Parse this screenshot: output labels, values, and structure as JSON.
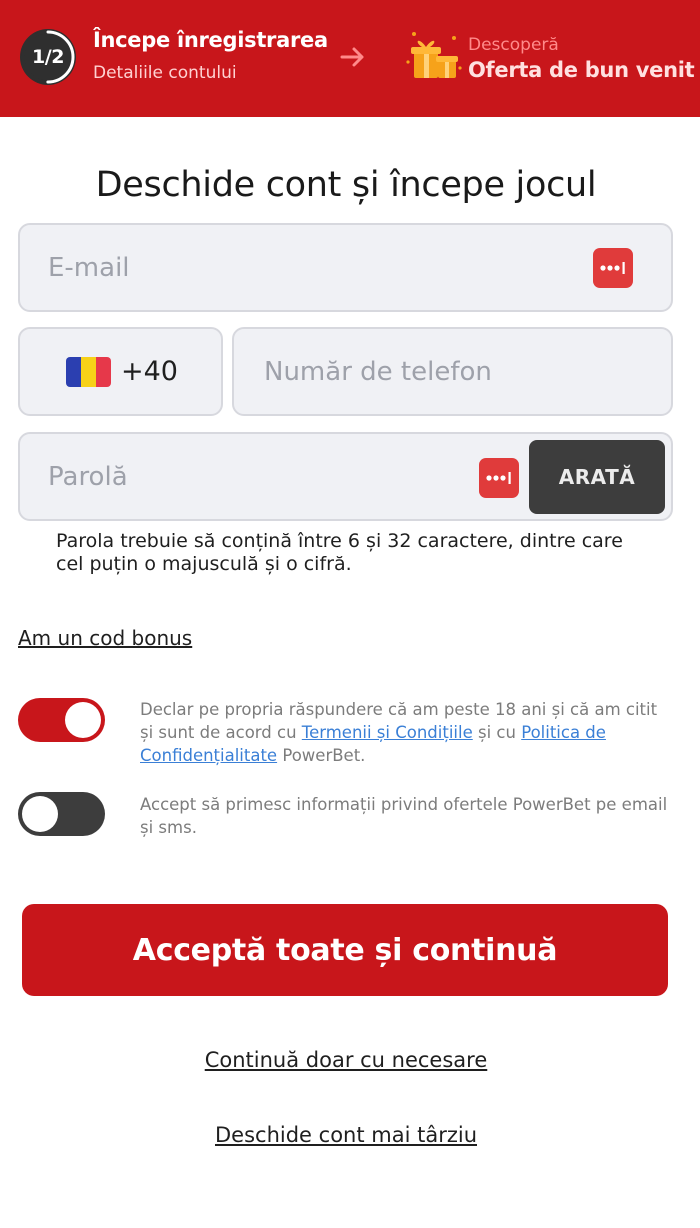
{
  "header": {
    "step_counter": "1/2",
    "step_progress": 0.5,
    "step_title": "Începe înregistrarea",
    "step_subtitle": "Detaliile contului",
    "next_label": "Descoperă",
    "next_title": "Oferta de bun venit"
  },
  "form": {
    "title": "Deschide cont și începe jocul",
    "email": {
      "placeholder": "E-mail",
      "value": ""
    },
    "phone": {
      "country_flag": "romania-flag",
      "prefix": "+40",
      "placeholder": "Număr de telefon",
      "value": ""
    },
    "password": {
      "placeholder": "Parolă",
      "value": "",
      "show_label": "ARATĂ",
      "hint": "Parola trebuie să conțină între 6 și 32 caractere, dintre care cel puțin o majusculă și o cifră."
    },
    "bonus_link": "Am un cod bonus"
  },
  "consents": {
    "age": {
      "checked": true,
      "text_before": "Declar pe propria răspundere că am peste 18 ani și că am citit și sunt de acord cu ",
      "terms_link": "Termenii și Condițiile",
      "text_middle": " și cu ",
      "privacy_link": "Politica de Confidențialitate",
      "text_after": " PowerBet."
    },
    "marketing": {
      "checked": false,
      "text": "Accept să primesc informații privind ofertele PowerBet pe email și sms."
    }
  },
  "actions": {
    "accept_all": "Acceptă toate și continuă",
    "necessary_only": "Continuă doar cu necesare",
    "later": "Deschide cont mai târziu"
  },
  "colors": {
    "brand_red": "#c8161b",
    "toggle_off": "#3d3d3d",
    "link_blue": "#3a7fd6",
    "field_bg": "#f0f1f5"
  }
}
